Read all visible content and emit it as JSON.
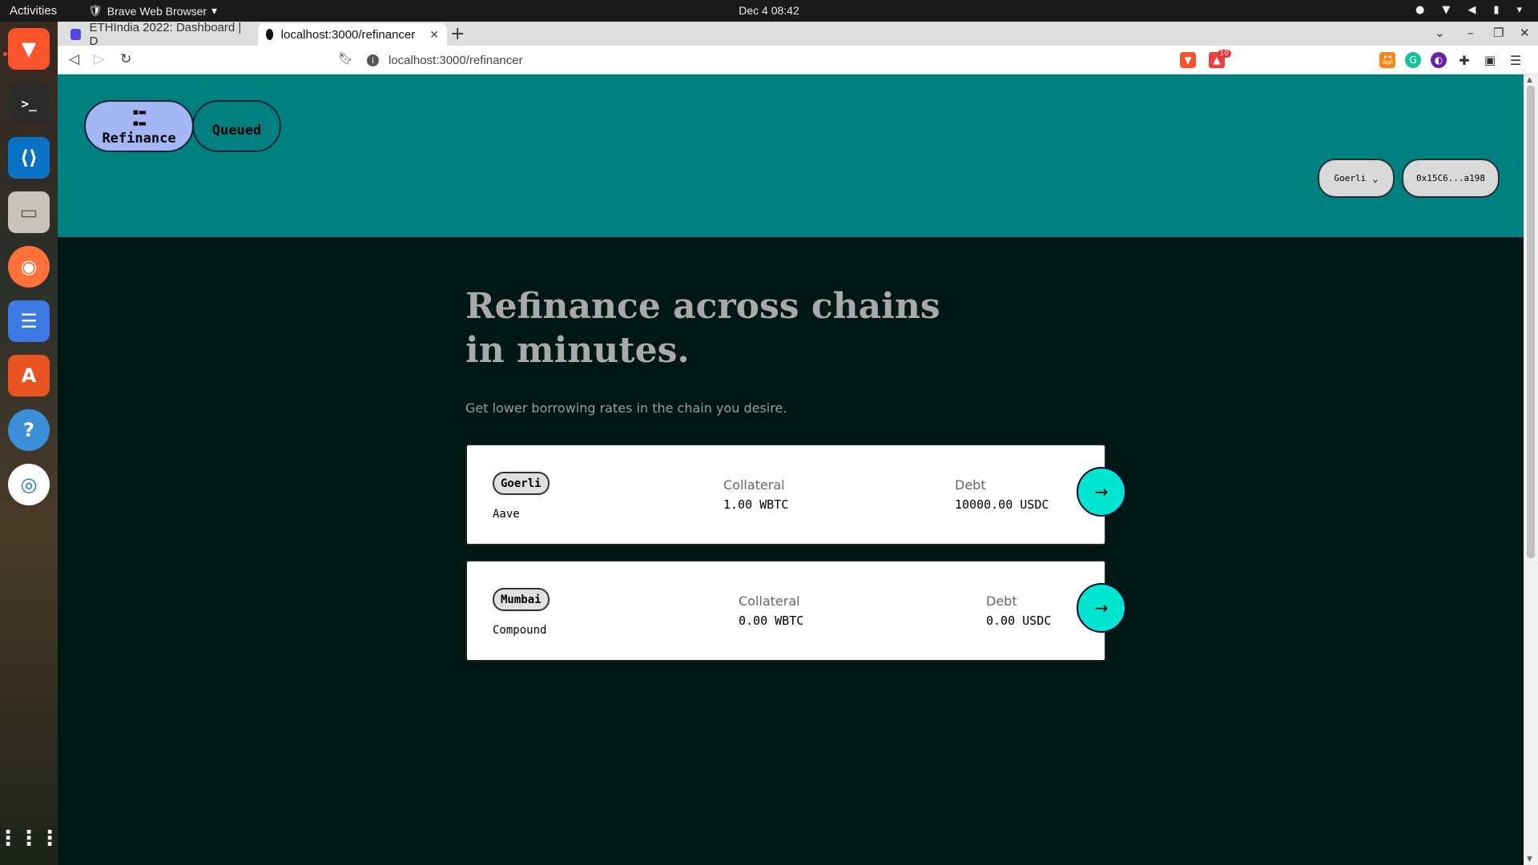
{
  "os": {
    "activities": "Activities",
    "app_name": "Brave Web Browser",
    "clock": "Dec 4  08:42"
  },
  "browser": {
    "tabs": [
      {
        "title": "ETHIndia 2022: Dashboard | D"
      },
      {
        "title": "localhost:3000/refinancer"
      }
    ],
    "url": "localhost:3000/refinancer",
    "brave_rewards_count": "10"
  },
  "app": {
    "nav": {
      "refinance_label": "Refinance",
      "queued_label": "Queued"
    },
    "chain_select": {
      "selected": "Goerli"
    },
    "wallet_address": "0x15C6...a198",
    "hero": {
      "title_line1": "Refinance across chains",
      "title_line2": "in minutes.",
      "subtitle": "Get lower borrowing rates in the chain you desire."
    },
    "positions": [
      {
        "chain": "Goerli",
        "protocol": "Aave",
        "collateral_label": "Collateral",
        "collateral_value": "1.00 WBTC",
        "debt_label": "Debt",
        "debt_value": "10000.00 USDC",
        "action": "→"
      },
      {
        "chain": "Mumbai",
        "protocol": "Compound",
        "collateral_label": "Collateral",
        "collateral_value": "0.00 WBTC",
        "debt_label": "Debt",
        "debt_value": "0.00 USDC",
        "action": "→"
      }
    ]
  }
}
